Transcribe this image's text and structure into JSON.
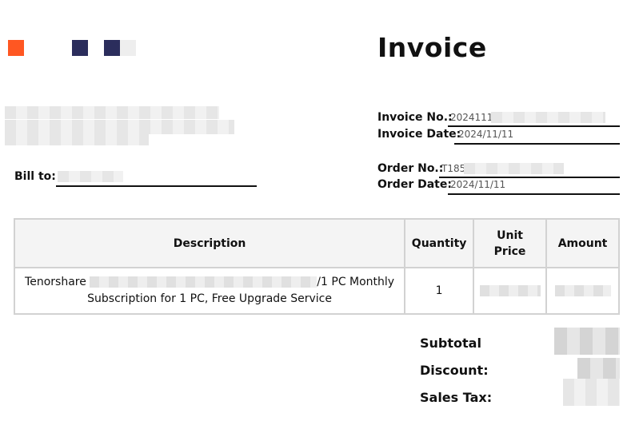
{
  "brand_colors": {
    "orange": "#ff5722",
    "navy": "#2b2d5c"
  },
  "invoice": {
    "title": "Invoice",
    "invoice_no_label": "Invoice No.:",
    "invoice_no_value": "2024111",
    "invoice_date_label": "Invoice Date:",
    "invoice_date_value": "2024/11/11",
    "order_no_label": "Order No.:",
    "order_no_value": "T185",
    "order_date_label": "Order Date:",
    "order_date_value": "2024/11/11",
    "bill_to_label": "Bill to:"
  },
  "table": {
    "headers": {
      "description": "Description",
      "quantity": "Quantity",
      "unit_price": "Unit Price",
      "amount": "Amount"
    },
    "rows": [
      {
        "desc_start": "Tenorshare",
        "desc_end": "/1 PC Monthly",
        "desc_line2": "Subscription for 1 PC, Free Upgrade Service",
        "quantity": "1"
      }
    ]
  },
  "totals": {
    "subtotal_label": "Subtotal",
    "discount_label": "Discount:",
    "sales_tax_label": "Sales Tax:"
  }
}
